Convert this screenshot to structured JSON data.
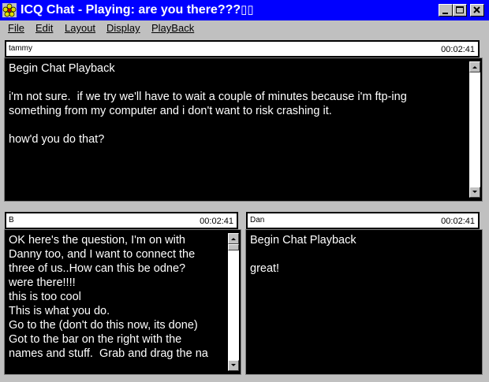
{
  "window": {
    "title": "ICQ Chat - Playing: are you there???",
    "title_marks": "▯▯",
    "icon": "icq-flower-icon",
    "colors": {
      "titlebar": "#0000ff",
      "chat_bg": "#000000",
      "chat_text": "#ffffff",
      "chrome": "#c0c0c0"
    }
  },
  "menu": [
    "File",
    "Edit",
    "Layout",
    "Display",
    "PlayBack"
  ],
  "panes": {
    "tammy": {
      "name": "tammy",
      "time": "00:02:41",
      "text": "Begin Chat Playback\n\ni'm not sure.  if we try we'll have to wait a couple of minutes because i'm ftp-ing\nsomething from my computer and i don't want to risk crashing it.\n\nhow'd you do that?"
    },
    "b": {
      "name": "B",
      "time": "00:02:41",
      "text": "OK here's the question, I'm on with\nDanny too, and I want to connect the\nthree of us..How can this be odne?\nwere there!!!!\nthis is too cool\nThis is what you do.\nGo to the (don't do this now, its done)\nGot to the bar on the right with the\nnames and stuff.  Grab and drag the na"
    },
    "dan": {
      "name": "Dan",
      "time": "00:02:41",
      "text": "Begin Chat Playback\n\ngreat!"
    }
  }
}
